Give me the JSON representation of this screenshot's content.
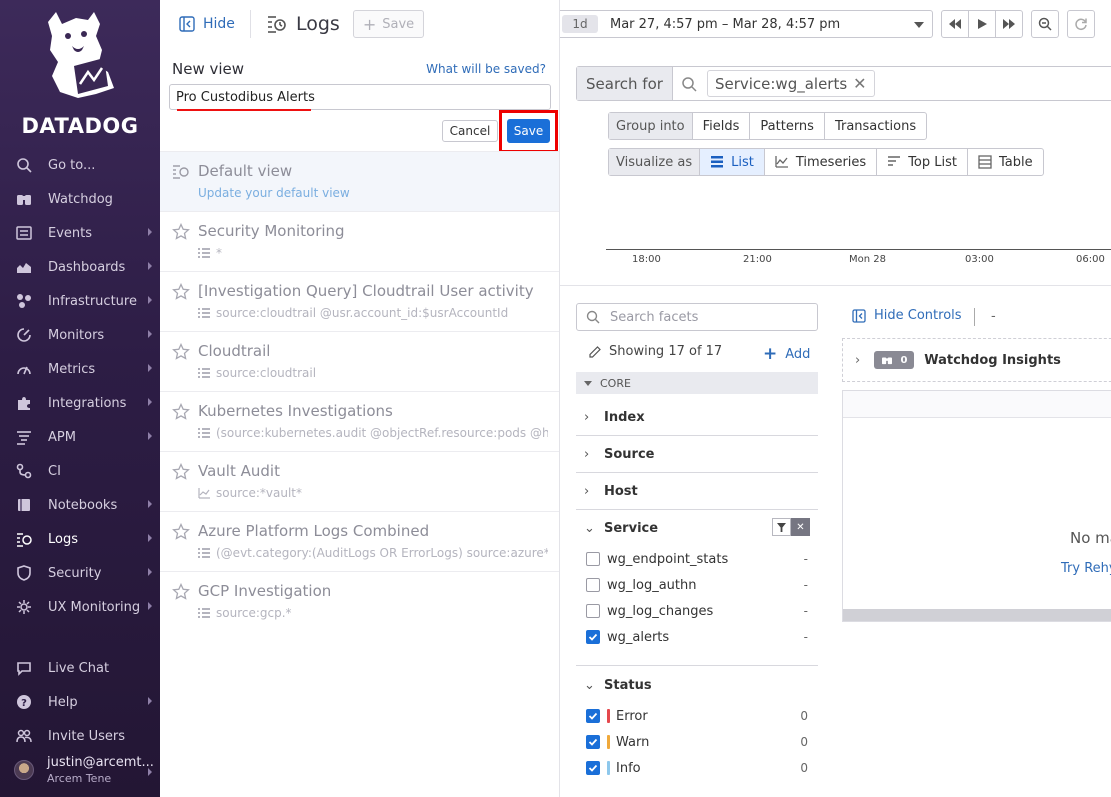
{
  "nav": {
    "brand": "DATADOG",
    "items": [
      {
        "label": "Go to...",
        "icon": "search-icon",
        "chevron": false
      },
      {
        "label": "Watchdog",
        "icon": "binoculars-icon",
        "chevron": false
      },
      {
        "label": "Events",
        "icon": "events-icon",
        "chevron": true
      },
      {
        "label": "Dashboards",
        "icon": "dashboard-icon",
        "chevron": true
      },
      {
        "label": "Infrastructure",
        "icon": "infrastructure-icon",
        "chevron": true
      },
      {
        "label": "Monitors",
        "icon": "monitor-icon",
        "chevron": true
      },
      {
        "label": "Metrics",
        "icon": "metrics-icon",
        "chevron": true
      },
      {
        "label": "Integrations",
        "icon": "puzzle-icon",
        "chevron": true
      },
      {
        "label": "APM",
        "icon": "apm-icon",
        "chevron": true
      },
      {
        "label": "CI",
        "icon": "ci-icon",
        "chevron": false
      },
      {
        "label": "Notebooks",
        "icon": "notebook-icon",
        "chevron": true
      },
      {
        "label": "Logs",
        "icon": "logs-icon",
        "chevron": true
      },
      {
        "label": "Security",
        "icon": "shield-icon",
        "chevron": true
      },
      {
        "label": "UX Monitoring",
        "icon": "ux-icon",
        "chevron": true
      }
    ],
    "bottom": [
      {
        "label": "Live Chat",
        "icon": "chat-icon",
        "chevron": false
      },
      {
        "label": "Help",
        "icon": "help-icon",
        "chevron": true
      },
      {
        "label": "Invite Users",
        "icon": "users-icon",
        "chevron": false
      }
    ],
    "user": {
      "email": "justin@arcemt...",
      "org": "Arcem Tene"
    }
  },
  "views_panel": {
    "hide_label": "Hide",
    "title": "Logs",
    "save_label": "Save",
    "new_view_label": "New view",
    "what_saved_link": "What will be saved?",
    "new_view_value": "Pro Custodibus Alerts",
    "cancel_label": "Cancel",
    "confirm_save_label": "Save",
    "default_view": {
      "title": "Default view",
      "sub": "Update your default view"
    },
    "views": [
      {
        "title": "Security Monitoring",
        "query": "*",
        "icon": "list-icon"
      },
      {
        "title": "[Investigation Query] Cloudtrail User activity",
        "query": "source:cloudtrail @usr.account_id:$usrAccountId",
        "icon": "list-icon"
      },
      {
        "title": "Cloudtrail",
        "query": "source:cloudtrail",
        "icon": "list-icon"
      },
      {
        "title": "Kubernetes Investigations",
        "query": "(source:kubernetes.audit @objectRef.resource:pods @ht...",
        "icon": "list-icon"
      },
      {
        "title": "Vault Audit",
        "query": "source:*vault*",
        "icon": "timeseries-icon"
      },
      {
        "title": "Azure Platform Logs Combined",
        "query": "(@evt.category:(AuditLogs OR ErrorLogs) source:azure* ...",
        "icon": "list-icon"
      },
      {
        "title": "GCP Investigation",
        "query": "source:gcp.*",
        "icon": "list-icon"
      }
    ]
  },
  "timebar": {
    "badge": "1d",
    "range": "Mar 27, 4:57 pm – Mar 28, 4:57 pm"
  },
  "search": {
    "label": "Search for",
    "chip": "Service:wg_alerts"
  },
  "group_into": {
    "label": "Group into",
    "options": [
      "Fields",
      "Patterns",
      "Transactions"
    ]
  },
  "visualize": {
    "label": "Visualize as",
    "options": [
      "List",
      "Timeseries",
      "Top List",
      "Table"
    ],
    "selected": "List"
  },
  "chart_ticks": [
    "18:00",
    "21:00",
    "Mon 28",
    "03:00",
    "06:00"
  ],
  "facets": {
    "search_placeholder": "Search facets",
    "showing": "Showing 17 of 17",
    "add_label": "Add",
    "core_label": "CORE",
    "groups": [
      "Index",
      "Source",
      "Host"
    ],
    "service": {
      "label": "Service",
      "values": [
        {
          "name": "wg_endpoint_stats",
          "checked": false,
          "count": "-"
        },
        {
          "name": "wg_log_authn",
          "checked": false,
          "count": "-"
        },
        {
          "name": "wg_log_changes",
          "checked": false,
          "count": "-"
        },
        {
          "name": "wg_alerts",
          "checked": true,
          "count": "-"
        }
      ]
    },
    "status": {
      "label": "Status",
      "values": [
        {
          "name": "Error",
          "count": "0",
          "color": "#e5484d"
        },
        {
          "name": "Warn",
          "count": "0",
          "color": "#f0a93b"
        },
        {
          "name": "Info",
          "count": "0",
          "color": "#8ec8ec"
        }
      ]
    }
  },
  "results": {
    "hide_controls": "Hide Controls",
    "dash": "-",
    "watchdog_count": "0",
    "watchdog_title": "Watchdog Insights",
    "no_match": "No ma",
    "try": "Try Rehy"
  }
}
